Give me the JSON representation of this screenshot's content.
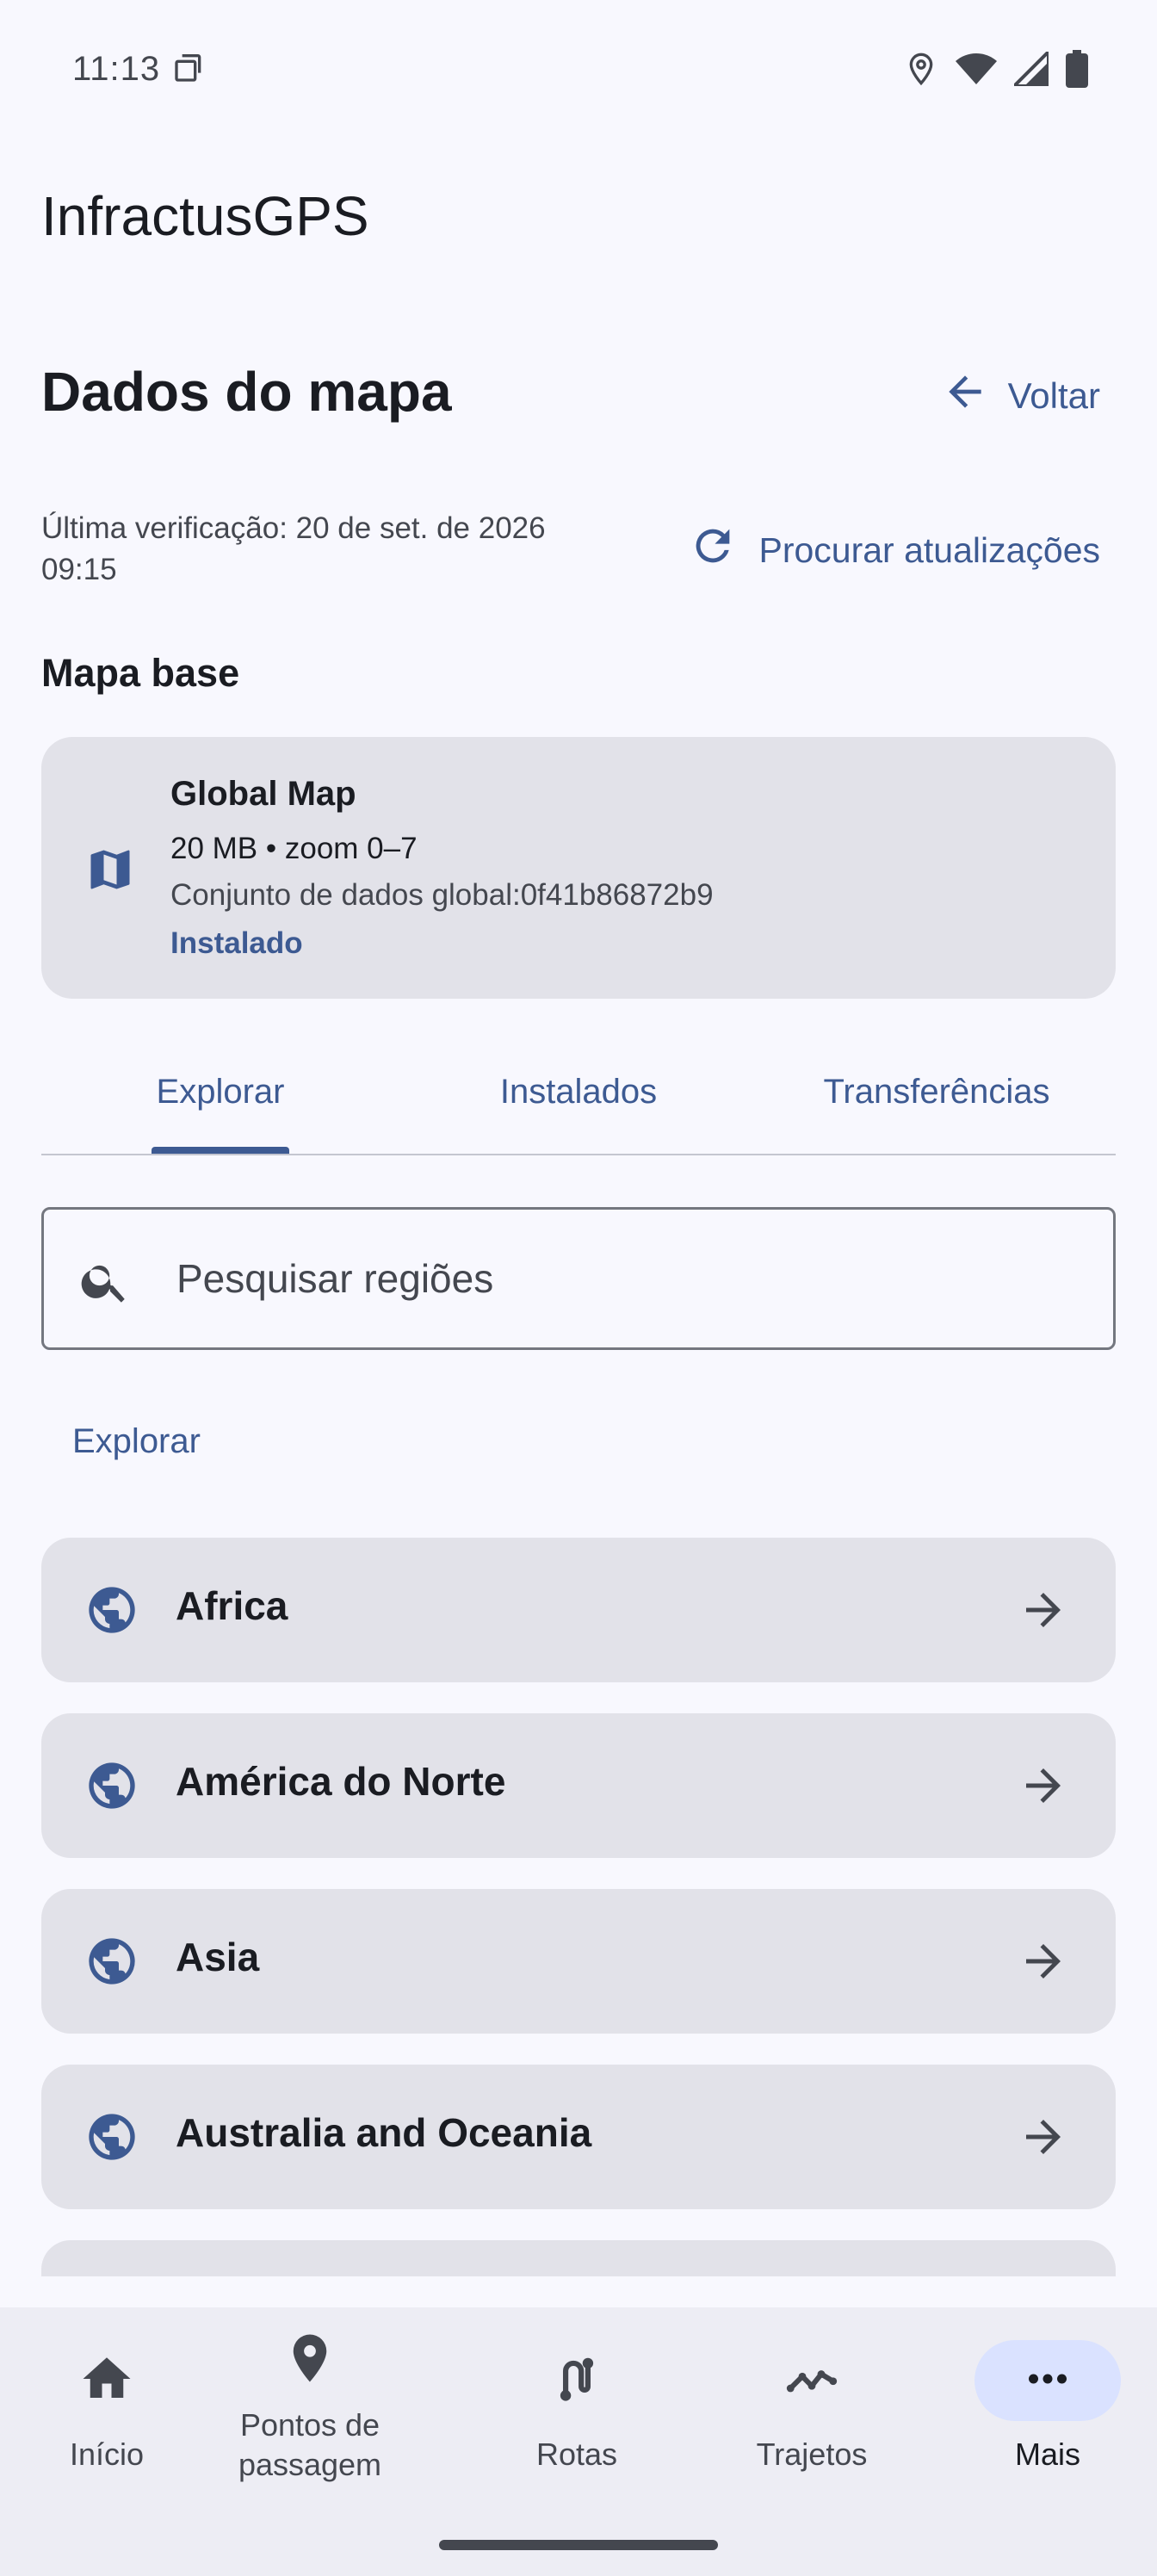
{
  "status_bar": {
    "time": "11:13",
    "icons": [
      "screenshot-icon",
      "location-icon",
      "wifi-icon",
      "signal-icon",
      "battery-icon"
    ]
  },
  "app": {
    "title": "InfractusGPS"
  },
  "header": {
    "title": "Dados do mapa",
    "back_label": "Voltar"
  },
  "updates": {
    "last_check": "Última verificação: 20 de set. de 2026 09:15",
    "check_label": "Procurar atualizações"
  },
  "base_map": {
    "section_title": "Mapa base",
    "name": "Global Map",
    "meta": "20 MB • zoom 0–7",
    "dataset": "Conjunto de dados global:0f41b86872b9",
    "status": "Instalado"
  },
  "tabs": [
    {
      "label": "Explorar",
      "selected": true
    },
    {
      "label": "Instalados",
      "selected": false
    },
    {
      "label": "Transferências",
      "selected": false
    }
  ],
  "search": {
    "placeholder": "Pesquisar regiões",
    "value": ""
  },
  "explore": {
    "heading": "Explorar",
    "regions": [
      {
        "name": "Africa"
      },
      {
        "name": "América do Norte"
      },
      {
        "name": "Asia"
      },
      {
        "name": "Australia and Oceania"
      },
      {
        "name": ""
      }
    ]
  },
  "bottom_nav": {
    "items": [
      {
        "label": "Início",
        "icon": "home-icon",
        "active": false
      },
      {
        "label": "Pontos de passagem",
        "icon": "location-pin-icon",
        "active": false
      },
      {
        "label": "Rotas",
        "icon": "route-icon",
        "active": false
      },
      {
        "label": "Trajetos",
        "icon": "track-icon",
        "active": false
      },
      {
        "label": "Mais",
        "icon": "more-icon",
        "active": true
      }
    ]
  },
  "colors": {
    "accent": "#3d5a92",
    "background": "#f8f8fe",
    "card": "#e2e2e9",
    "nav_background": "#ededf4",
    "nav_active_pill": "#dae2ff",
    "text_primary": "#1a1c22",
    "text_secondary": "#44474f"
  }
}
